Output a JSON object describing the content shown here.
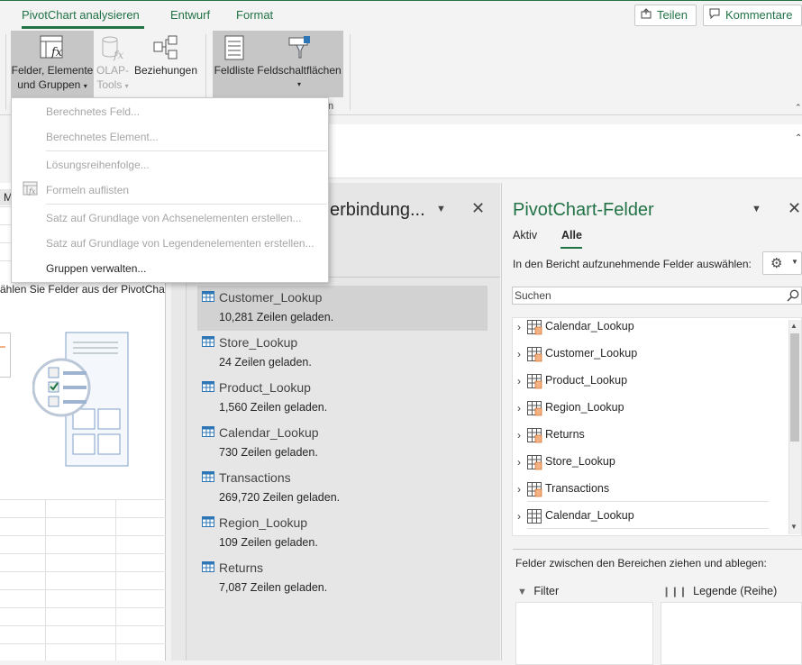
{
  "ribbon": {
    "tabs": [
      "PivotChart analysieren",
      "Entwurf",
      "Format"
    ],
    "share_label": "Teilen",
    "comments_label": "Kommentare",
    "buttons": {
      "fields_items_line1": "Felder, Elemente",
      "fields_items_line2": "und Gruppen",
      "olap_line1": "OLAP-",
      "olap_line2": "Tools",
      "relationships": "Beziehungen",
      "field_list": "Feldliste",
      "field_buttons": "Feldschaltflächen"
    },
    "group_label_fragment": "n"
  },
  "menu": {
    "items": [
      {
        "label": "Berechnetes Feld...",
        "enabled": false
      },
      {
        "label": "Berechnetes Element...",
        "enabled": false
      },
      {
        "label": "Lösungsreihenfolge...",
        "enabled": false
      },
      {
        "label": "Formeln auflisten",
        "enabled": false
      },
      {
        "label": "Satz auf Grundlage von Achsenelementen erstellen...",
        "enabled": false
      },
      {
        "label": "Satz auf Grundlage von Legendenelementen erstellen...",
        "enabled": false
      },
      {
        "label": "Gruppen verwalten...",
        "enabled": true
      }
    ]
  },
  "sheet": {
    "column_header": "M",
    "hint_text": "ählen Sie Felder aus der PivotCha"
  },
  "connections_pane": {
    "title": "erbindung...",
    "items": [
      {
        "name": "Customer_Lookup",
        "count": "10,281 Zeilen geladen."
      },
      {
        "name": "Store_Lookup",
        "count": "24 Zeilen geladen."
      },
      {
        "name": "Product_Lookup",
        "count": "1,560 Zeilen geladen."
      },
      {
        "name": "Calendar_Lookup",
        "count": "730 Zeilen geladen."
      },
      {
        "name": "Transactions",
        "count": "269,720 Zeilen geladen."
      },
      {
        "name": "Region_Lookup",
        "count": "109 Zeilen geladen."
      },
      {
        "name": "Returns",
        "count": "7,087 Zeilen geladen."
      }
    ]
  },
  "fields_pane": {
    "title": "PivotChart-Felder",
    "tab_active": "Aktiv",
    "tab_all": "Alle",
    "instruction": "In den Bericht aufzunehmende Felder auswählen:",
    "search_placeholder": "Suchen",
    "tables": [
      "Calendar_Lookup",
      "Customer_Lookup",
      "Product_Lookup",
      "Region_Lookup",
      "Returns",
      "Store_Lookup",
      "Transactions",
      "Calendar_Lookup"
    ],
    "areas_label": "Felder zwischen den Bereichen ziehen und ablegen:",
    "area_filter": "Filter",
    "area_legend": "Legende (Reihe)"
  },
  "colors": {
    "accent": "#217346",
    "disabled_text": "#a6a6a6",
    "selected_row": "#d2d2d2"
  }
}
